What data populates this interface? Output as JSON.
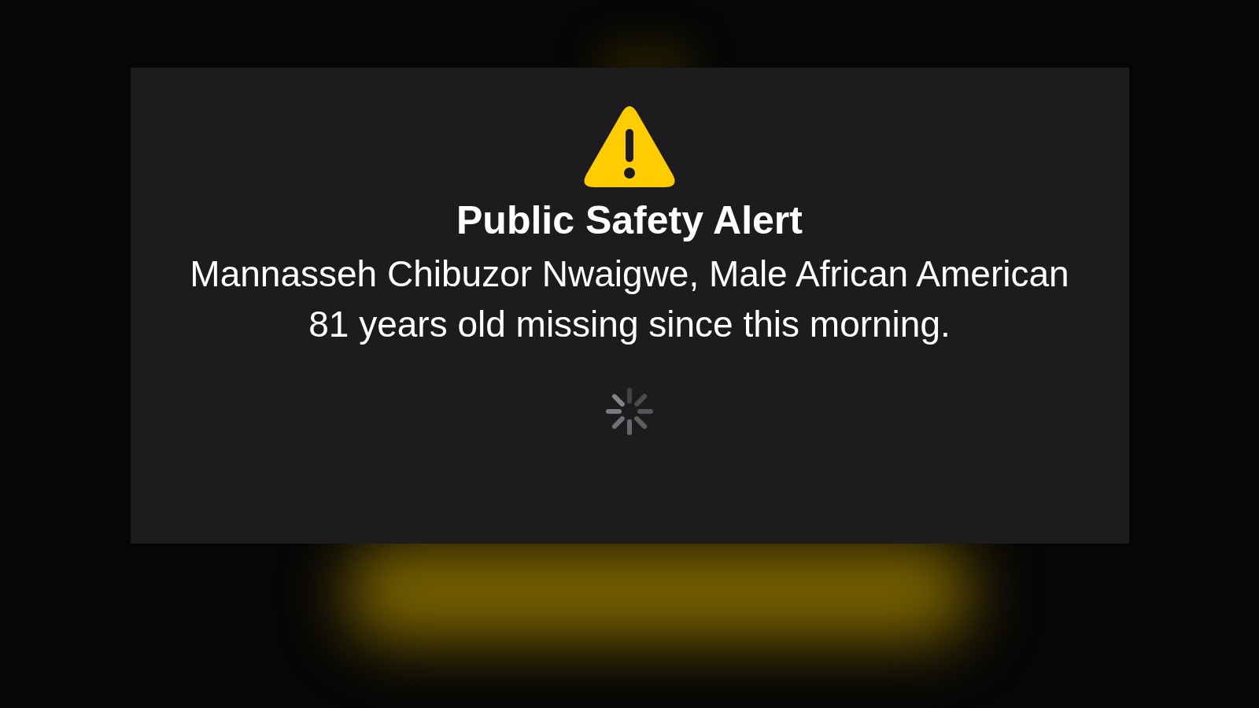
{
  "alert": {
    "title": "Public Safety Alert",
    "message": "Mannasseh Chibuzor Nwaigwe, Male African American 81 years old missing since this morning.",
    "loading": true
  }
}
